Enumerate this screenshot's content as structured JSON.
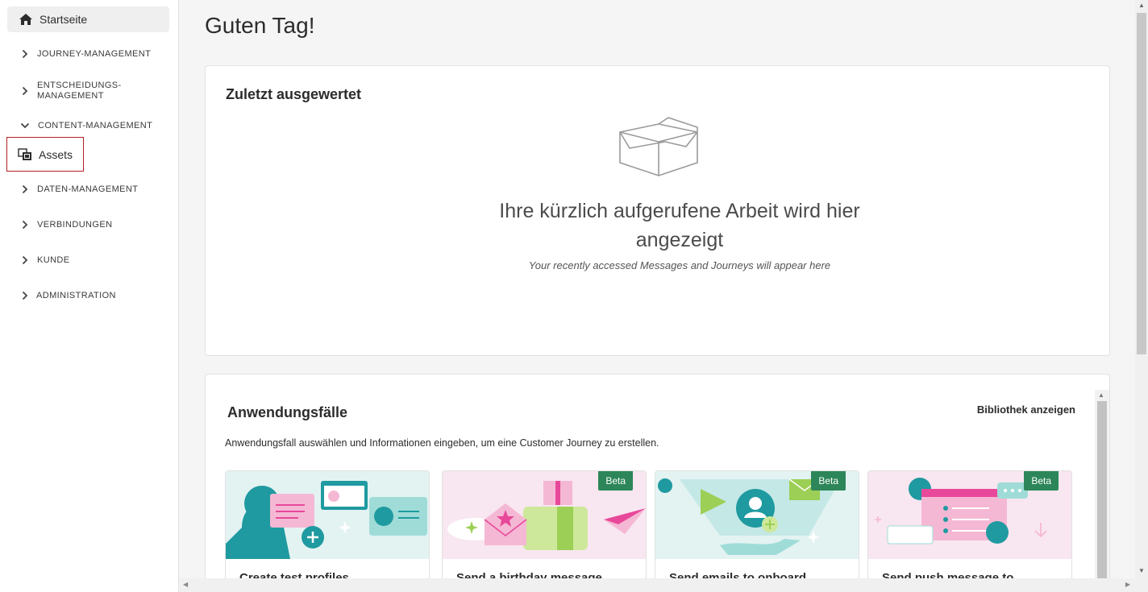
{
  "sidebar": {
    "home_label": "Startseite",
    "items": [
      {
        "label": "JOURNEY-MANAGEMENT"
      },
      {
        "label": "ENTSCHEIDUNGS-\nMANAGEMENT"
      },
      {
        "label": "CONTENT-MANAGEMENT"
      },
      {
        "label": "DATEN-MANAGEMENT"
      },
      {
        "label": "VERBINDUNGEN"
      },
      {
        "label": "KUNDE"
      },
      {
        "label": "ADMINISTRATION"
      }
    ],
    "assets_label": "Assets"
  },
  "main": {
    "title": "Guten Tag!",
    "recent": {
      "title": "Zuletzt ausgewertet",
      "empty_line1": "Ihre kürzlich aufgerufene Arbeit wird hier",
      "empty_line2": "angezeigt",
      "empty_sub": "Your recently accessed Messages and Journeys will appear here"
    },
    "use_cases": {
      "title": "Anwendungsfälle",
      "library_link": "Bibliothek anzeigen",
      "description": "Anwendungsfall auswählen und Informationen eingeben, um eine Customer Journey zu erstellen.",
      "cards": [
        {
          "title": "Create test profiles",
          "badge": ""
        },
        {
          "title": "Send a birthday message",
          "badge": "Beta"
        },
        {
          "title": "Send emails to onboard",
          "badge": "Beta"
        },
        {
          "title": "Send push message to",
          "badge": "Beta"
        }
      ]
    }
  },
  "colors": {
    "accent_badge": "#2d8659",
    "highlight_border": "#b41f24",
    "teal": "#1f9aa0",
    "pink": "#e8489a"
  }
}
